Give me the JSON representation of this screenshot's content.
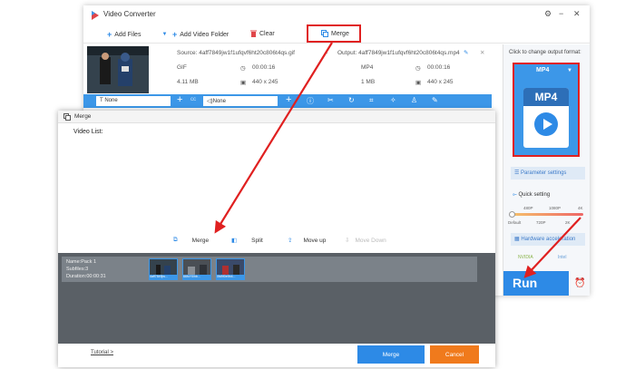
{
  "app": {
    "title": "Video Converter",
    "window_controls": [
      "⚙",
      "−",
      "✕"
    ]
  },
  "toolbar": {
    "add_files": "Add Files",
    "add_video_folder": "Add Video Folder",
    "clear": "Clear",
    "merge": "Merge"
  },
  "source": {
    "label": "Source: 4aff7849jw1f1ufqvf6ht20c806t4qs.gif",
    "format": "GIF",
    "duration": "00:00:16",
    "size": "4.11 MB",
    "resolution": "440 x 245"
  },
  "output": {
    "label": "Output: 4aff7849jw1f1ufqvf6ht20c806t4qs.mp4",
    "format": "MP4",
    "duration": "00:00:16",
    "size": "1 MB",
    "resolution": "440 x 245"
  },
  "bluebar": {
    "subtitle_value": "None",
    "audio_value": "None"
  },
  "output_panel": {
    "hint": "Click to change output format:",
    "format": "MP4",
    "icon_text": "MP4",
    "param_settings": "Parameter settings",
    "quick_setting": "Quick setting",
    "ticks_top": [
      "480P",
      "1080P",
      "4K"
    ],
    "ticks_bottom": [
      "Default",
      "720P",
      "2K"
    ],
    "hw_accel": "Hardware acceleration",
    "hw_brands": [
      "NVIDIA",
      "Intel"
    ],
    "run": "Run"
  },
  "merge_dialog": {
    "title": "Merge",
    "video_list_label": "Video List:",
    "actions": {
      "merge": "Merge",
      "split": "Split",
      "move_up": "Move up",
      "move_down": "Move Down"
    },
    "pack": {
      "name": "Name:Pack 1",
      "subfiles": "Subfiles:3",
      "duration": "Duration:00:00:31",
      "thumbs": [
        "4aff7849jw...",
        "66fcYI0hb...",
        "0fd9f0e9b4..."
      ]
    },
    "tutorial": "Tutorial >",
    "merge_button": "Merge",
    "cancel_button": "Cancel"
  },
  "colors": {
    "accent_blue": "#2d8ae6",
    "highlight_red": "#e02020",
    "cancel_orange": "#f07a1c"
  }
}
